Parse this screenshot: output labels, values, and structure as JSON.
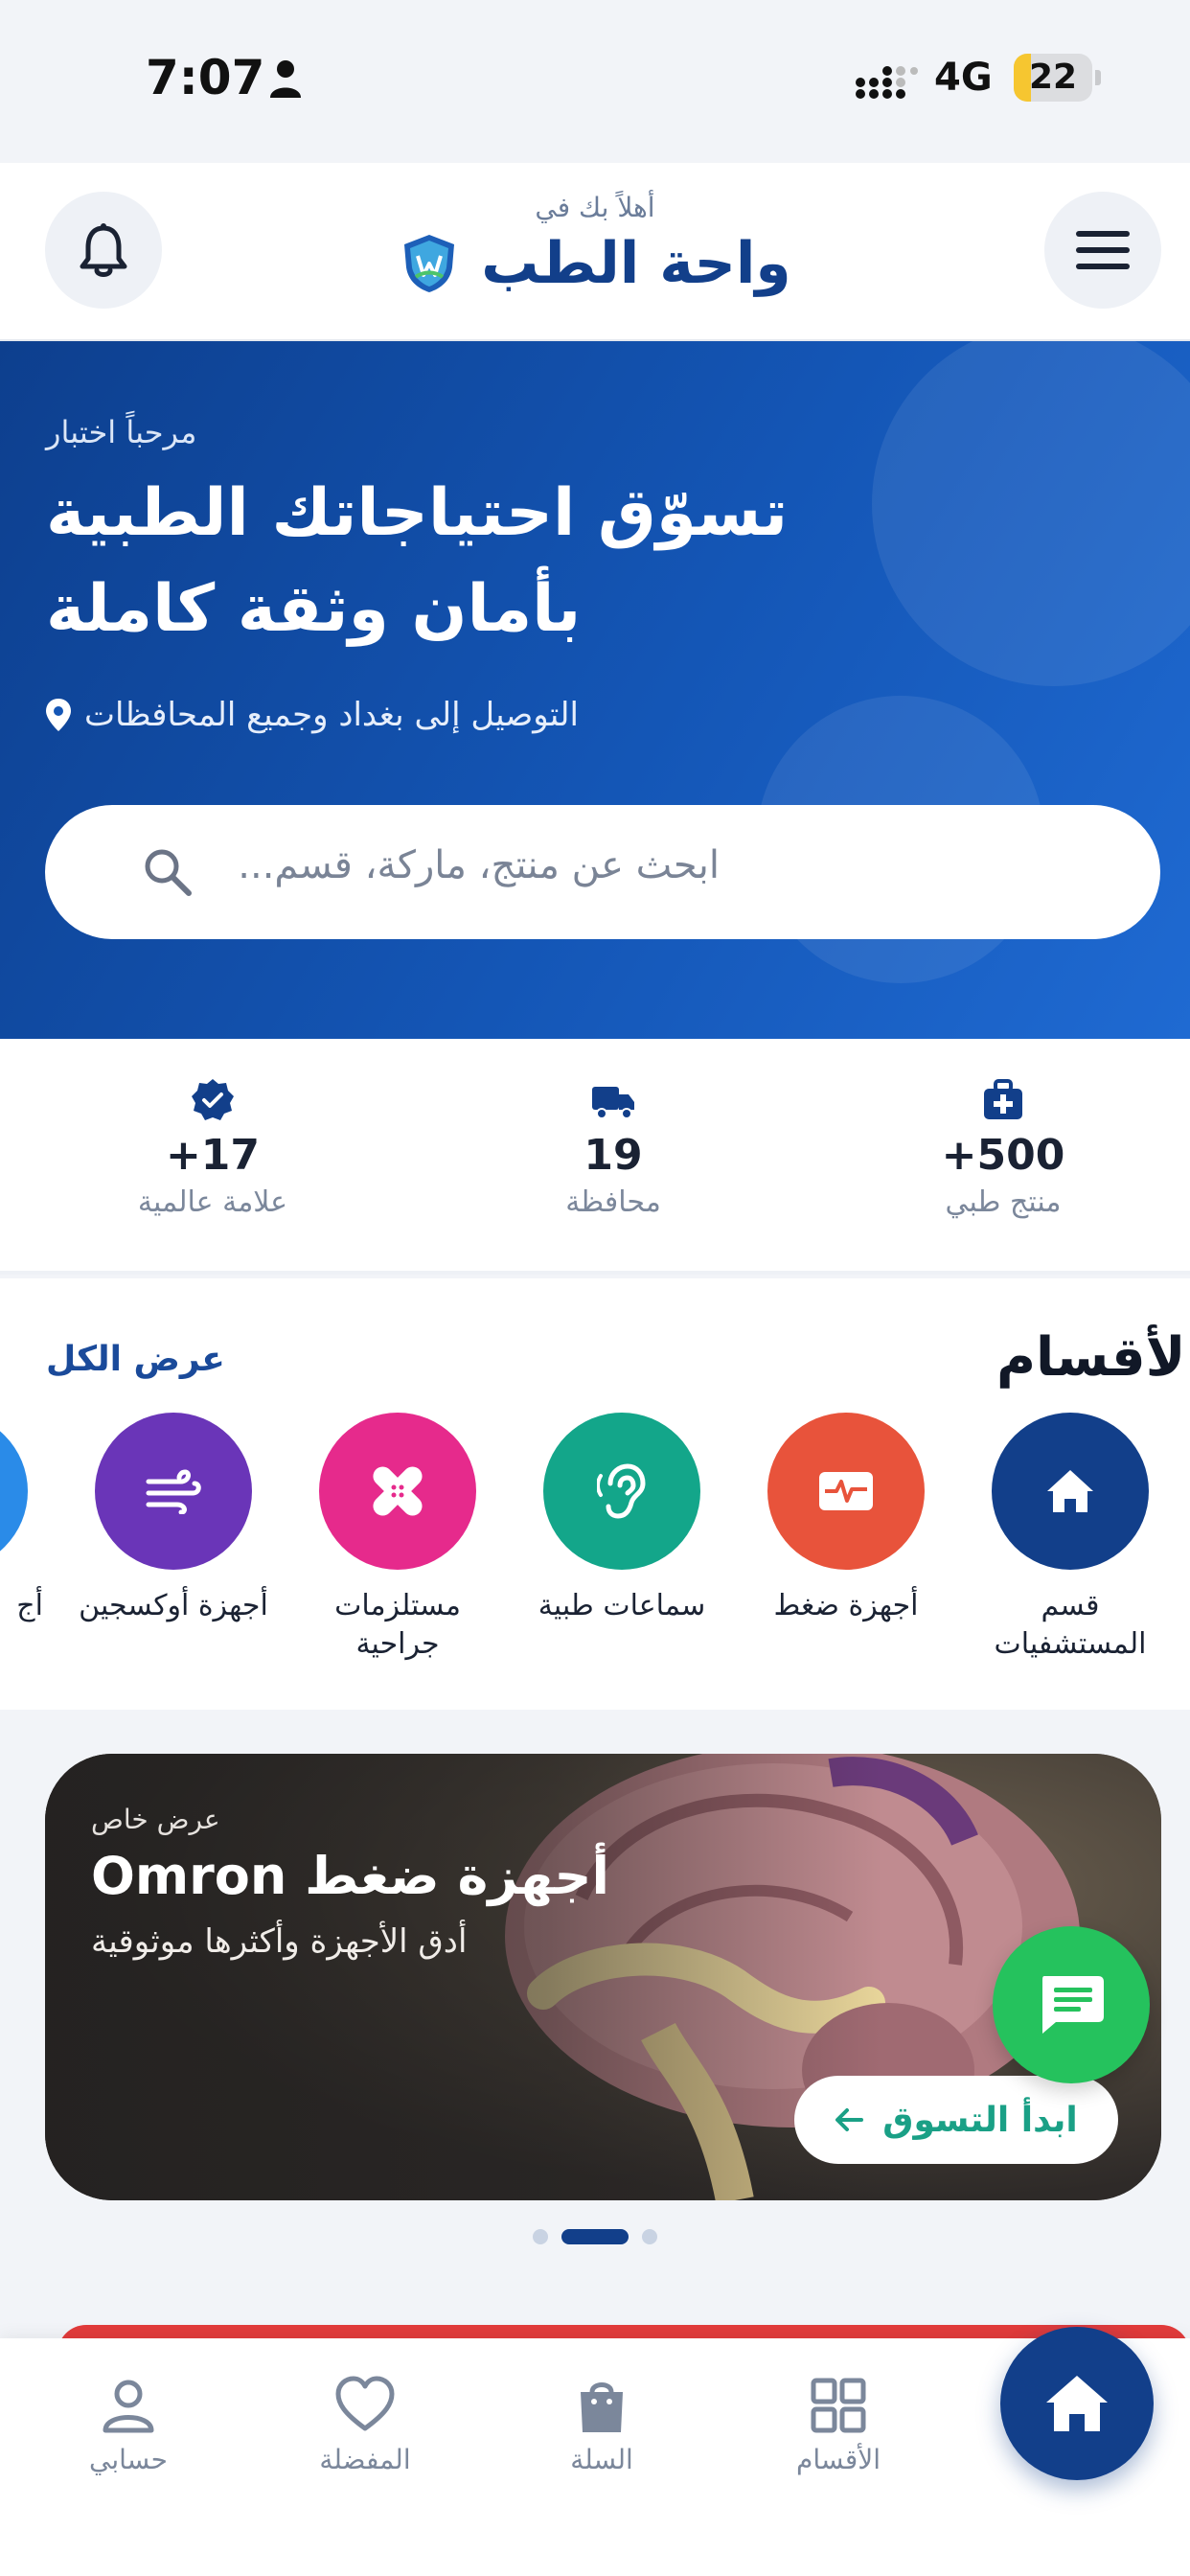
{
  "status_bar": {
    "time": "7:07",
    "network": "4G",
    "battery": "22",
    "battery_level": 0.22
  },
  "header": {
    "welcome": "أهلاً بك في",
    "brand": "واحة الطب"
  },
  "hero": {
    "greeting": "مرحباً اختبار",
    "title_line1": "تسوّق احتياجاتك الطبية",
    "title_line2": "بأمان وثقة كاملة",
    "delivery": "التوصيل إلى بغداد وجميع المحافظات",
    "search_placeholder": "ابحث عن منتج، ماركة، قسم..."
  },
  "stats": [
    {
      "icon": "medical-kit-icon",
      "value": "+500",
      "label": "منتج طبي"
    },
    {
      "icon": "truck-icon",
      "value": "19",
      "label": "محافظة"
    },
    {
      "icon": "verified-badge-icon",
      "value": "+17",
      "label": "علامة عالمية"
    }
  ],
  "categories": {
    "title": "الأقسام",
    "view_all": "عرض الكل",
    "items": [
      {
        "label": "قسم المستشفيات",
        "icon": "home-icon",
        "color": "#123f8a"
      },
      {
        "label": "أجهزة ضغط",
        "icon": "heart-monitor-icon",
        "color": "#e8533b"
      },
      {
        "label": "سماعات طبية",
        "icon": "ear-icon",
        "color": "#13a68a"
      },
      {
        "label": "مستلزمات جراحية",
        "icon": "bandage-icon",
        "color": "#e62a8c"
      },
      {
        "label": "أجهزة أوكسجين",
        "icon": "wind-icon",
        "color": "#6a35b8"
      },
      {
        "label": "أج",
        "icon": "partial-icon",
        "color": "#2a8be8"
      }
    ]
  },
  "promo": {
    "tag": "عرض خاص",
    "title": "أجهزة ضغط Omron",
    "subtitle": "أدق الأجهزة وأكثرها موثوقية",
    "cta": "ابدأ التسوق"
  },
  "bottom_nav": [
    {
      "label": "حسابي",
      "icon": "user-icon"
    },
    {
      "label": "المفضلة",
      "icon": "heart-icon"
    },
    {
      "label": "السلة",
      "icon": "shopping-bag-icon"
    },
    {
      "label": "الأقسام",
      "icon": "grid-icon"
    }
  ],
  "colors": {
    "primary": "#123f8a",
    "accent_green": "#25c25d",
    "cta_text": "#1aa086"
  }
}
